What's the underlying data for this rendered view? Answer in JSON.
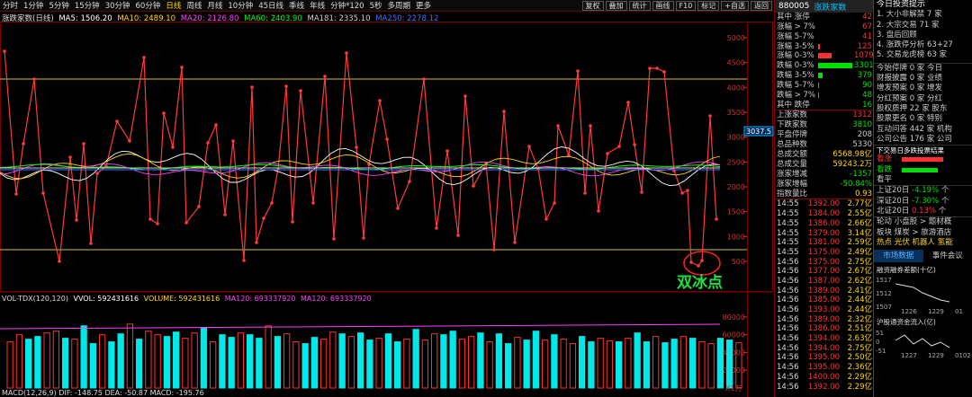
{
  "toolbar": {
    "periods": [
      "分时",
      "1分钟",
      "5分钟",
      "15分钟",
      "30分钟",
      "60分钟",
      "日线",
      "周线",
      "月线",
      "10分钟",
      "45日线",
      "季线",
      "年线",
      "分钟*120",
      "5秒",
      "多周期",
      "更多"
    ],
    "active_index": 6,
    "buttons": [
      "复权",
      "叠加",
      "统计",
      "画线",
      "F10",
      "标记",
      "+自选",
      "返回"
    ]
  },
  "legend": {
    "title": "涨跌家数(日线)",
    "ma5": "MA5: 1506.20",
    "ma10": "MA10: 2489.10",
    "ma20": "MA20: 2126.80",
    "ma60": "MA60: 2403.90",
    "ma181": "MA181: 2335.10",
    "ma250": "MA250: 2278.12"
  },
  "price_axis": [
    "5000",
    "4500",
    "4000",
    "3500",
    "3000",
    "2500",
    "2000",
    "1500",
    "1000",
    "500"
  ],
  "price_marker": "3037.5",
  "annotation": "双冰点",
  "vol_legend": {
    "title": "VOL-TDX(120,120)",
    "vvol": "VVOL: 592431616",
    "volume": "VOLUME: 592431616",
    "ma120": "MA120: 693337920",
    "ma120b": "MA120: 693337920"
  },
  "vol_axis": [
    "80000",
    "60000",
    "40000",
    "20000"
  ],
  "vol_unit": "X1万",
  "macd_legend": "MACD(12,26,9)  DIF: -148.75  DEA: -50.87  MACD: -195.76",
  "colors": {
    "bg": "#000000",
    "up": "#ff3030",
    "down": "#00e0e0",
    "yellow": "#ffd800",
    "accent": "#00c0ff"
  },
  "panel": {
    "code": "880005",
    "name": "涨跌家数",
    "rows": [
      {
        "label": "其中 涨停",
        "value": "42",
        "color": "#ff3030",
        "bar": 0
      },
      {
        "label": "涨幅 > 7%",
        "value": "67",
        "color": "#ff3030",
        "bar": 0
      },
      {
        "label": "涨幅 5-7%",
        "value": "41",
        "color": "#ff3030",
        "bar": 0
      },
      {
        "label": "涨幅 3-5%",
        "value": "125",
        "color": "#ff3030",
        "bar": 0.05
      },
      {
        "label": "涨幅 0-3%",
        "value": "1079",
        "color": "#ff3030",
        "bar": 0.4
      },
      {
        "label": "跌幅 0-3%",
        "value": "3301",
        "color": "#00e000",
        "bar": 1
      },
      {
        "label": "跌幅 3-5%",
        "value": "379",
        "color": "#00e000",
        "bar": 0.13
      },
      {
        "label": "跌幅 5-7%",
        "value": "90",
        "color": "#00e000",
        "bar": 0.03
      },
      {
        "label": "跌幅 > 7%",
        "value": "48",
        "color": "#00e000",
        "bar": 0.02
      },
      {
        "label": "其中 跌停",
        "value": "16",
        "color": "#00e000",
        "bar": 0
      }
    ],
    "stats": [
      {
        "label": "上涨家数",
        "value": "1312",
        "color": "#ff3030"
      },
      {
        "label": "下跌家数",
        "value": "3810",
        "color": "#00e000"
      },
      {
        "label": "平盘停牌",
        "value": "208",
        "color": "#ccc"
      },
      {
        "label": "总品种数",
        "value": "5330",
        "color": "#ccc"
      },
      {
        "label": "总成交额",
        "value": "6568.98亿",
        "color": "#ffd800"
      },
      {
        "label": "总成交量",
        "value": "59243.2万",
        "color": "#ffd800"
      },
      {
        "label": "涨家增减",
        "value": "-1357",
        "color": "#00e000"
      },
      {
        "label": "涨家增幅",
        "value": "-50.84%",
        "color": "#00e000"
      },
      {
        "label": "指数量比",
        "value": "0.93",
        "color": "#ffd800"
      }
    ],
    "ticks": [
      [
        "14:55",
        "1392.00",
        "2.77亿"
      ],
      [
        "14:55",
        "1384.00",
        "2.55亿"
      ],
      [
        "14:55",
        "1386.00",
        "2.66亿"
      ],
      [
        "14:55",
        "1379.00",
        "3.14亿"
      ],
      [
        "14:55",
        "1381.00",
        "2.59亿"
      ],
      [
        "14:55",
        "1375.00",
        "2.49亿"
      ],
      [
        "14:56",
        "1375.00",
        "2.75亿"
      ],
      [
        "14:56",
        "1377.00",
        "2.67亿"
      ],
      [
        "14:56",
        "1387.00",
        "2.62亿"
      ],
      [
        "14:56",
        "1389.00",
        "2.41亿"
      ],
      [
        "14:56",
        "1385.00",
        "2.44亿"
      ],
      [
        "14:56",
        "1393.00",
        "2.44亿"
      ],
      [
        "14:56",
        "1389.00",
        "2.32亿"
      ],
      [
        "14:56",
        "1386.00",
        "2.51亿"
      ],
      [
        "14:56",
        "1394.00",
        "2.63亿"
      ],
      [
        "14:56",
        "1394.00",
        "2.75亿"
      ],
      [
        "14:56",
        "1395.00",
        "2.50亿"
      ],
      [
        "14:56",
        "1395.00",
        "2.36亿"
      ],
      [
        "14:56",
        "1400.00",
        "2.29亿"
      ],
      [
        "14:56",
        "1392.00",
        "2.29亿"
      ]
    ]
  },
  "panel2": {
    "title": "今日投资提示",
    "tips": [
      "1. 大小非解禁 7 家",
      "2. 大宗交易 71 家",
      "3. 盘后回顾",
      "4. 涨跌停分析 63+27",
      "5. 交易龙虎榜 63 家"
    ],
    "lines": [
      "今始停牌  0 家  今日",
      "财报披露  0 家  业绩",
      "增发预案  0 家  增发",
      "分红预案  0 家  分红",
      "股权质押  22 家  股东",
      "股票更名  0 家  特别",
      "互动问答  442 家  机构",
      "公司公告  176 家  公司"
    ],
    "vote_title": "下交易日多跌投票结果",
    "votes": [
      {
        "label": "看涨",
        "color": "#ff3030"
      },
      {
        "label": "看跌",
        "color": "#00e000"
      },
      {
        "label": "看平",
        "color": "#ccc"
      }
    ],
    "indices": [
      {
        "name": "上证20日",
        "value": "-4.19%",
        "tail": "个"
      },
      {
        "name": "深证20日",
        "value": "-7.30%",
        "tail": "个"
      },
      {
        "name": "北证20日",
        "value": "0.13%",
        "tail": "个"
      }
    ],
    "hot": [
      "轮动 小盘股 > 题材概",
      "板块 煤炭 > 旅游酒店",
      "热点 光伏 机器人 氢能"
    ],
    "tabs": [
      "市场数据",
      "事件会议"
    ],
    "fund1_title": "融资融券差额(十亿)",
    "fund1_vals": [
      "1517",
      "1512",
      "1507"
    ],
    "fund1_dates": [
      "1226",
      "1229",
      "01"
    ],
    "fund2_title": "沪股通资金流入(亿)",
    "fund2_vals": [
      "51",
      "0",
      "-51"
    ],
    "fund2_dates": [
      "1227",
      "1229",
      "0102"
    ]
  }
}
